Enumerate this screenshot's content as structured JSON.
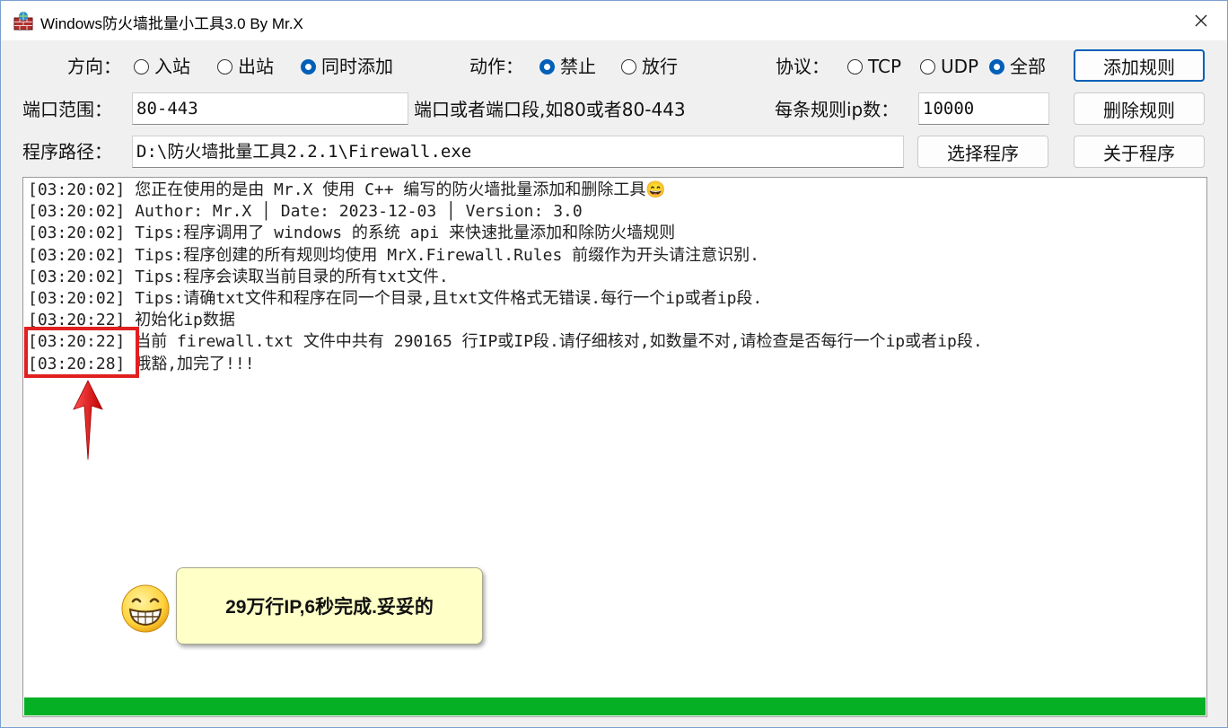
{
  "window": {
    "title": "Windows防火墙批量小工具3.0 By Mr.X",
    "icon": "firewall-app-icon",
    "close": "close-icon"
  },
  "direction": {
    "label": "方向：",
    "options": [
      "入站",
      "出站",
      "同时添加"
    ],
    "selected": "同时添加"
  },
  "action": {
    "label": "动作：",
    "options": [
      "禁止",
      "放行"
    ],
    "selected": "禁止"
  },
  "protocol": {
    "label": "协议：",
    "options": [
      "TCP",
      "UDP",
      "全部"
    ],
    "selected": "全部"
  },
  "port": {
    "label": "端口范围：",
    "value": "80-443",
    "hint": "端口或者端口段,如80或者80-443"
  },
  "per_rule": {
    "label": "每条规则ip数：",
    "value": "10000"
  },
  "path": {
    "label": "程序路径：",
    "value": "D:\\防火墙批量工具2.2.1\\Firewall.exe"
  },
  "buttons": {
    "add": "添加规则",
    "delete": "删除规则",
    "choose": "选择程序",
    "about": "关于程序"
  },
  "log": [
    "[03:20:02] 您正在使用的是由 Mr.X 使用 C++ 编写的防火墙批量添加和删除工具😄",
    "[03:20:02] Author: Mr.X │ Date: 2023-12-03 │ Version: 3.0",
    "[03:20:02] Tips:程序调用了 windows 的系统 api 来快速批量添加和除防火墙规则",
    "[03:20:02] Tips:程序创建的所有规则均使用 MrX.Firewall.Rules 前缀作为开头请注意识别.",
    "[03:20:02] Tips:程序会读取当前目录的所有txt文件.",
    "[03:20:02] Tips:请确txt文件和程序在同一个目录,且txt文件格式无错误.每行一个ip或者ip段.",
    "[03:20:22] 初始化ip数据",
    "[03:20:22] 当前 firewall.txt 文件中共有 290165 行IP或IP段.请仔细核对,如数量不对,请检查是否每行一个ip或者ip段.",
    "[03:20:28] 哦豁,加完了!!!"
  ],
  "annotation": {
    "note": "29万行IP,6秒完成.妥妥的",
    "emoji": "grinning-face-icon",
    "arrow": "red-arrow-icon",
    "highlight_color": "#e02020"
  },
  "progress": {
    "value": 1.0,
    "color": "#06b025"
  },
  "colors": {
    "accent": "#005fb8",
    "note_bg": "#ffffc8"
  }
}
